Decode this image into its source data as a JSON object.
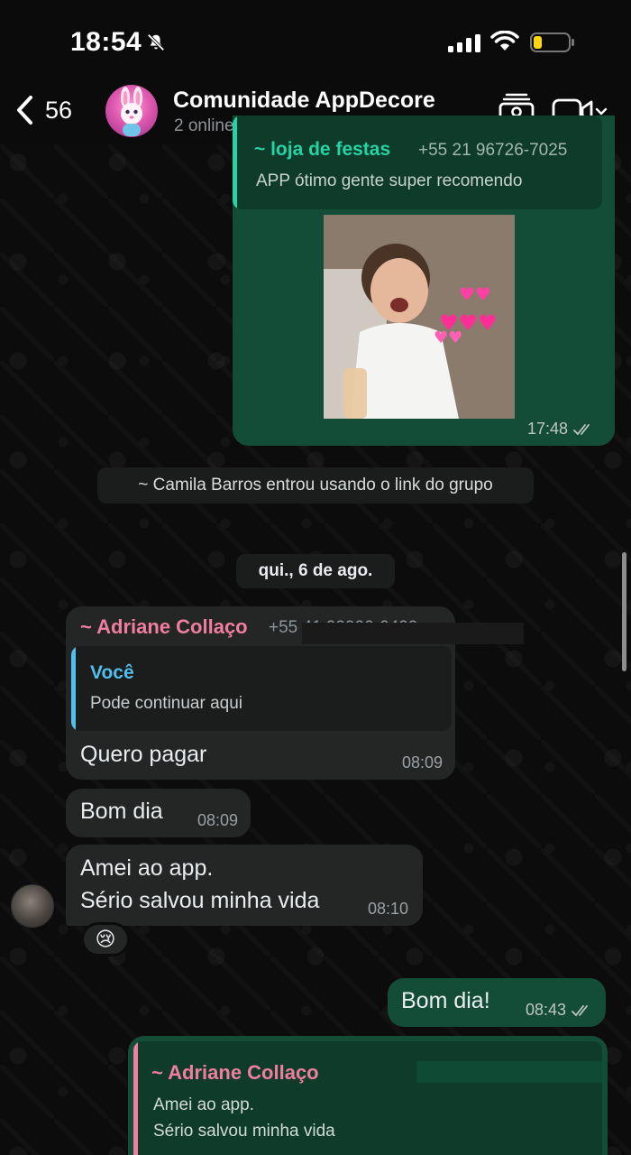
{
  "status_bar": {
    "time": "18:54"
  },
  "header": {
    "back_count": "56",
    "title": "Comunidade AppDecore",
    "subtitle": "2 online"
  },
  "messages": {
    "m1": {
      "quote_sender": "~ loja de festas",
      "quote_phone": "+55 21 96726-7025",
      "quote_text": "APP ótimo gente super recomendo",
      "time": "17:48"
    },
    "system": "~ Camila Barros entrou usando o link do grupo",
    "date": "qui., 6 de ago.",
    "m2": {
      "sender": "~ Adriane Collaço",
      "sender_phone": "+55 41 99990-0400",
      "quote_sender": "Você",
      "quote_text": "Pode continuar aqui",
      "text": "Quero pagar",
      "time": "08:09"
    },
    "m3": {
      "text": "Bom dia",
      "time": "08:09"
    },
    "m4": {
      "line1": "Amei ao app.",
      "line2": "Sério salvou minha vida",
      "time": "08:10",
      "reaction": "😢"
    },
    "m5": {
      "text": "Bom dia!",
      "time": "08:43"
    },
    "m6": {
      "quote_sender": "~ Adriane Collaço",
      "quote_line1": "Amei ao app.",
      "quote_line2": "Sério salvou minha vida"
    }
  },
  "colors": {
    "outgoing_bubble": "#144d37",
    "incoming_bubble": "#242626",
    "quote_accent_teal": "#53bdeb",
    "quote_accent_pink": "#f07ea0",
    "sender_pink": "#f07ea0",
    "quote_sender_blue": "#53bdeb",
    "quote_sender_teal": "#25d3a5"
  },
  "icons": {
    "bell": "bell-off-icon",
    "signal": "signal-icon",
    "wifi": "wifi-icon",
    "battery": "battery-icon",
    "back": "chevron-left-icon",
    "members": "members-icon",
    "video": "video-camera-icon",
    "ticks": "double-check-icon"
  }
}
